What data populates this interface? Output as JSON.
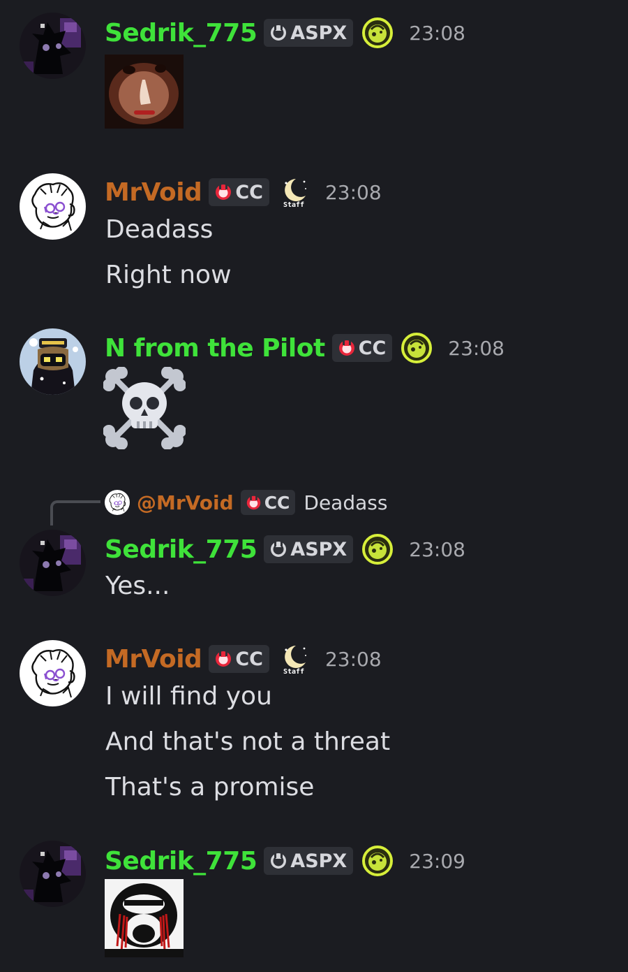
{
  "colors": {
    "background": "#1b1c21",
    "green_name": "#3fe23a",
    "brown_name": "#c46a24",
    "tag_bg": "#2e3036",
    "timestamp": "#a8a9ae"
  },
  "messages": [
    {
      "author": "Sedrik_775",
      "tag": "ASPX",
      "tag_icon": "gray-circle-icon",
      "badge_icon": "green-moon-badge-icon",
      "time": "23:08",
      "attachment": "creepy-face-image"
    },
    {
      "author": "MrVoid",
      "tag": "CC",
      "tag_icon": "red-circle-icon",
      "badge_icon": "staff-moon-icon",
      "time": "23:08",
      "lines": [
        "Deadass",
        "Right now"
      ]
    },
    {
      "author": "N from the Pilot",
      "tag": "CC",
      "tag_icon": "red-circle-icon",
      "badge_icon": "green-moon-badge-icon",
      "time": "23:08",
      "emoji": "skull-and-crossbones-emoji"
    },
    {
      "reply": {
        "mention": "@MrVoid",
        "tag": "CC",
        "text": "Deadass"
      },
      "author": "Sedrik_775",
      "tag": "ASPX",
      "tag_icon": "gray-circle-icon",
      "badge_icon": "green-moon-badge-icon",
      "time": "23:08",
      "lines": [
        "Yes..."
      ]
    },
    {
      "author": "MrVoid",
      "tag": "CC",
      "tag_icon": "red-circle-icon",
      "badge_icon": "staff-moon-icon",
      "time": "23:08",
      "lines": [
        "I will find you",
        "And that's not a threat",
        "That's a promise"
      ]
    },
    {
      "author": "Sedrik_775",
      "tag": "ASPX",
      "tag_icon": "gray-circle-icon",
      "badge_icon": "green-moon-badge-icon",
      "time": "23:09",
      "attachment": "screaming-face-image"
    }
  ]
}
